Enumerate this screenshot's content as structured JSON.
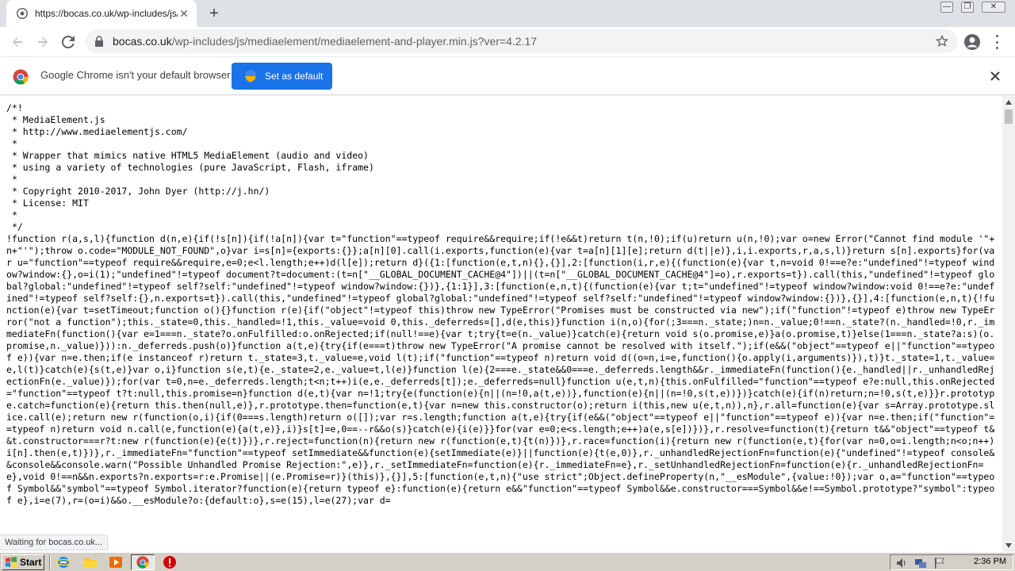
{
  "tab": {
    "title": "https://bocas.co.uk/wp-includes/js/m",
    "close_label": "✕",
    "newtab_label": "+"
  },
  "window_controls": [
    "—",
    "❐",
    "✕"
  ],
  "address": {
    "host": "bocas.co.uk",
    "path": "/wp-includes/js/mediaelement/mediaelement-and-player.min.js?ver=4.2.17"
  },
  "infobar": {
    "message": "Google Chrome isn't your default browser",
    "button_label": "Set as default"
  },
  "code_text": "/*!\n * MediaElement.js\n * http://www.mediaelementjs.com/\n *\n * Wrapper that mimics native HTML5 MediaElement (audio and video)\n * using a variety of technologies (pure JavaScript, Flash, iframe)\n *\n * Copyright 2010-2017, John Dyer (http://j.hn/)\n * License: MIT\n *\n */\n!function r(a,s,l){function d(n,e){if(!s[n]){if(!a[n]){var t=\"function\"==typeof require&&require;if(!e&&t)return t(n,!0);if(u)return u(n,!0);var o=new Error(\"Cannot find module '\"+n+\"'\");throw o.code=\"MODULE_NOT_FOUND\",o}var i=s[n]={exports:{}};a[n][0].call(i.exports,function(e){var t=a[n][1][e];return d(t||e)},i,i.exports,r,a,s,l)}return s[n].exports}for(var u=\"function\"==typeof require&&require,e=0;e<l.length;e++)d(l[e]);return d}({1:[function(e,t,n){},{}],2:[function(i,r,e){(function(e){var t,n=void 0!==e?e:\"undefined\"!=typeof window?window:{},o=i(1);\"undefined\"!=typeof document?t=document:(t=n[\"__GLOBAL_DOCUMENT_CACHE@4\"])||(t=n[\"__GLOBAL_DOCUMENT_CACHE@4\"]=o),r.exports=t}).call(this,\"undefined\"!=typeof global?global:\"undefined\"!=typeof self?self:\"undefined\"!=typeof window?window:{})},{1:1}],3:[function(e,n,t){(function(e){var t;t=\"undefined\"!=typeof window?window:void 0!==e?e:\"undefined\"!=typeof self?self:{},n.exports=t}).call(this,\"undefined\"!=typeof global?global:\"undefined\"!=typeof self?self:\"undefined\"!=typeof window?window:{})},{}],4:[function(e,n,t){!function(e){var t=setTimeout;function o(){}function r(e){if(\"object\"!=typeof this)throw new TypeError(\"Promises must be constructed via new\");if(\"function\"!=typeof e)throw new TypeError(\"not a function\");this._state=0,this._handled=!1,this._value=void 0,this._deferreds=[],d(e,this)}function i(n,o){for(;3===n._state;)n=n._value;0!==n._state?(n._handled=!0,r._immediateFn(function(){var e=1===n._state?o.onFulfilled:o.onRejected;if(null!==e){var t;try{t=e(n._value)}catch(e){return void s(o.promise,e)}a(o.promise,t)}else(1===n._state?a:s)(o.promise,n._value)})):n._deferreds.push(o)}function a(t,e){try{if(e===t)throw new TypeError(\"A promise cannot be resolved with itself.\");if(e&&(\"object\"==typeof e||\"function\"==typeof e)){var n=e.then;if(e instanceof r)return t._state=3,t._value=e,void l(t);if(\"function\"==typeof n)return void d((o=n,i=e,function(){o.apply(i,arguments)}),t)}t._state=1,t._value=e,l(t)}catch(e){s(t,e)}var o,i}function s(e,t){e._state=2,e._value=t,l(e)}function l(e){2===e._state&&0===e._deferreds.length&&r._immediateFn(function(){e._handled||r._unhandledRejectionFn(e._value)});for(var t=0,n=e._deferreds.length;t<n;t++)i(e,e._deferreds[t]);e._deferreds=null}function u(e,t,n){this.onFulfilled=\"function\"==typeof e?e:null,this.onRejected=\"function\"==typeof t?t:null,this.promise=n}function d(e,t){var n=!1;try{e(function(e){n||(n=!0,a(t,e))},function(e){n||(n=!0,s(t,e))})}catch(e){if(n)return;n=!0,s(t,e)}}r.prototype.catch=function(e){return this.then(null,e)},r.prototype.then=function(e,t){var n=new this.constructor(o);return i(this,new u(e,t,n)),n},r.all=function(e){var s=Array.prototype.slice.call(e);return new r(function(o,i){if(0===s.length)return o([]);var r=s.length;function a(t,e){try{if(e&&(\"object\"==typeof e||\"function\"==typeof e)){var n=e.then;if(\"function\"==typeof n)return void n.call(e,function(e){a(t,e)},i)}s[t]=e,0==--r&&o(s)}catch(e){i(e)}}for(var e=0;e<s.length;e++)a(e,s[e])})},r.resolve=function(t){return t&&\"object\"==typeof t&&t.constructor===r?t:new r(function(e){e(t)})},r.reject=function(n){return new r(function(e,t){t(n)})},r.race=function(i){return new r(function(e,t){for(var n=0,o=i.length;n<o;n++)i[n].then(e,t)})},r._immediateFn=\"function\"==typeof setImmediate&&function(e){setImmediate(e)}||function(e){t(e,0)},r._unhandledRejectionFn=function(e){\"undefined\"!=typeof console&&console&&console.warn(\"Possible Unhandled Promise Rejection:\",e)},r._setImmediateFn=function(e){r._immediateFn=e},r._setUnhandledRejectionFn=function(e){r._unhandledRejectionFn=e},void 0!==n&&n.exports?n.exports=r:e.Promise||(e.Promise=r)}(this)},{}],5:[function(e,t,n){\"use strict\";Object.defineProperty(n,\"__esModule\",{value:!0});var o,a=\"function\"==typeof Symbol&&\"symbol\"==typeof Symbol.iterator?function(e){return typeof e}:function(e){return e&&\"function\"==typeof Symbol&&e.constructor===Symbol&&e!==Symbol.prototype?\"symbol\":typeof e},i=e(7),r=(o=i)&&o.__esModule?o:{default:o},s=e(15),l=e(27);var d=",
  "status": "Waiting for bocas.co.uk...",
  "taskbar": {
    "start_label": "Start",
    "clock": "2:36 PM"
  }
}
